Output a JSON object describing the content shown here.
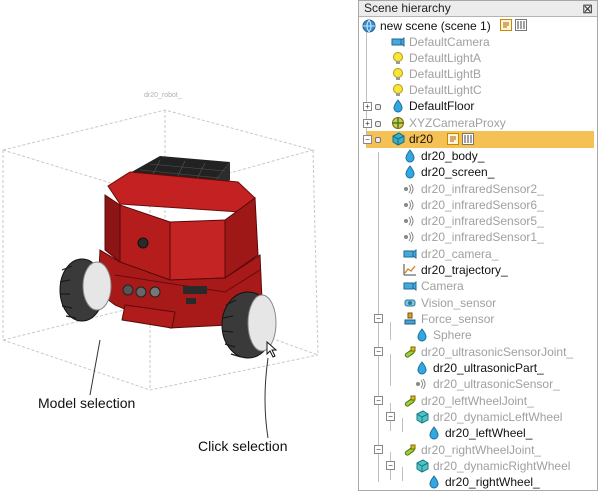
{
  "viewport": {
    "object_label": "dr20_robot_",
    "annotation_model": "Model selection",
    "annotation_click": "Click selection"
  },
  "hierarchy": {
    "title": "Scene hierarchy",
    "close_glyph": "⊠",
    "rows": [
      {
        "label": "new scene (scene 1)",
        "icon": "globe-icon",
        "state": "normal"
      },
      {
        "label": "DefaultCamera",
        "icon": "camera-icon",
        "state": "dim"
      },
      {
        "label": "DefaultLightA",
        "icon": "light-icon",
        "state": "dim"
      },
      {
        "label": "DefaultLightB",
        "icon": "light-icon",
        "state": "dim"
      },
      {
        "label": "DefaultLightC",
        "icon": "light-icon",
        "state": "dim"
      },
      {
        "label": "DefaultFloor",
        "icon": "shape-icon",
        "state": "normal"
      },
      {
        "label": "XYZCameraProxy",
        "icon": "dummy-icon",
        "state": "dim"
      },
      {
        "label": "dr20",
        "icon": "model-icon",
        "state": "selected"
      },
      {
        "label": "dr20_body_",
        "icon": "shape-icon",
        "state": "normal"
      },
      {
        "label": "dr20_screen_",
        "icon": "shape-icon",
        "state": "normal"
      },
      {
        "label": "dr20_infraredSensor2_",
        "icon": "proximity-sensor-icon",
        "state": "dim"
      },
      {
        "label": "dr20_infraredSensor6_",
        "icon": "proximity-sensor-icon",
        "state": "dim"
      },
      {
        "label": "dr20_infraredSensor5_",
        "icon": "proximity-sensor-icon",
        "state": "dim"
      },
      {
        "label": "dr20_infraredSensor1_",
        "icon": "proximity-sensor-icon",
        "state": "dim"
      },
      {
        "label": "dr20_camera_",
        "icon": "camera-icon",
        "state": "dim"
      },
      {
        "label": "dr20_trajectory_",
        "icon": "graph-icon",
        "state": "normal"
      },
      {
        "label": "Camera",
        "icon": "camera-icon",
        "state": "dim"
      },
      {
        "label": "Vision_sensor",
        "icon": "vision-sensor-icon",
        "state": "dim"
      },
      {
        "label": "Force_sensor",
        "icon": "force-sensor-icon",
        "state": "dim"
      },
      {
        "label": "Sphere",
        "icon": "shape-icon",
        "state": "dim"
      },
      {
        "label": "dr20_ultrasonicSensorJoint_",
        "icon": "joint-icon",
        "state": "dim"
      },
      {
        "label": "dr20_ultrasonicPart_",
        "icon": "shape-icon",
        "state": "normal"
      },
      {
        "label": "dr20_ultrasonicSensor_",
        "icon": "proximity-sensor-icon",
        "state": "dim"
      },
      {
        "label": "dr20_leftWheelJoint_",
        "icon": "joint-icon",
        "state": "dim"
      },
      {
        "label": "dr20_dynamicLeftWheel",
        "icon": "dynamic-shape-icon",
        "state": "dim"
      },
      {
        "label": "dr20_leftWheel_",
        "icon": "shape-icon",
        "state": "normal"
      },
      {
        "label": "dr20_rightWheelJoint_",
        "icon": "joint-icon",
        "state": "dim"
      },
      {
        "label": "dr20_dynamicRightWheel",
        "icon": "dynamic-shape-icon",
        "state": "dim"
      },
      {
        "label": "dr20_rightWheel_",
        "icon": "shape-icon",
        "state": "normal"
      }
    ]
  },
  "colors": {
    "selection": "#f5c155",
    "robot_red": "#b01c1c",
    "dim_text": "#a0a0a0"
  }
}
